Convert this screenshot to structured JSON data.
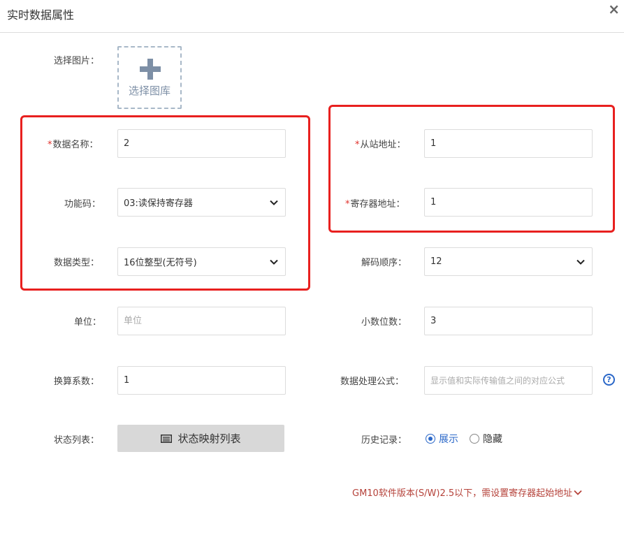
{
  "dialog": {
    "title": "实时数据属性",
    "close": "×"
  },
  "form": {
    "image": {
      "label": "选择图片：",
      "button": "选择图库"
    },
    "data_name": {
      "required": "*",
      "label": "数据名称：",
      "value": "2"
    },
    "function_code": {
      "label": "功能码：",
      "value": "03:读保持寄存器"
    },
    "data_type": {
      "label": "数据类型：",
      "value": "16位整型(无符号)"
    },
    "unit": {
      "label": "单位：",
      "placeholder": "单位"
    },
    "factor": {
      "label": "换算系数：",
      "value": "1"
    },
    "status_list": {
      "label": "状态列表：",
      "button": "状态映射列表"
    },
    "slave_address": {
      "required": "*",
      "label": "从站地址：",
      "value": "1"
    },
    "register_address": {
      "required": "*",
      "label": "寄存器地址：",
      "value": "1"
    },
    "decode_order": {
      "label": "解码顺序：",
      "value": "12"
    },
    "decimals": {
      "label": "小数位数：",
      "value": "3"
    },
    "formula": {
      "label": "数据处理公式：",
      "placeholder": "显示值和实际传输值之间的对应公式",
      "help": "?"
    },
    "history": {
      "label": "历史记录：",
      "options": [
        "展示",
        "隐藏"
      ],
      "selected": "展示"
    },
    "note": "GM10软件版本(S/W)2.5以下，需设置寄存器起始地址"
  },
  "colors": {
    "highlight": "#e8201f",
    "accent": "#2a67c8",
    "note": "#b5423a"
  },
  "icons": {
    "close": "close-icon",
    "add": "plus-icon",
    "list": "list-icon",
    "dropdown": "chevron-down-icon",
    "help": "help-icon"
  }
}
